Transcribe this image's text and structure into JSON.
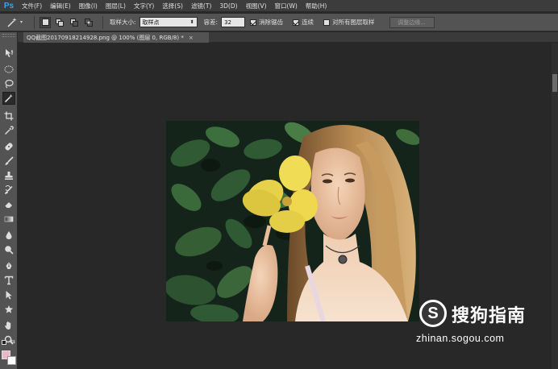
{
  "app": {
    "logo": "Ps"
  },
  "menubar": {
    "items": [
      "文件(F)",
      "编辑(E)",
      "图像(I)",
      "图层(L)",
      "文字(Y)",
      "选择(S)",
      "滤镜(T)",
      "3D(D)",
      "视图(V)",
      "窗口(W)",
      "帮助(H)"
    ]
  },
  "options": {
    "sample_size_label": "取样大小:",
    "sample_size_value": "取样点",
    "tolerance_label": "容差:",
    "tolerance_value": "32",
    "antialias_label": "消除锯齿",
    "antialias_checked": true,
    "contiguous_label": "连续",
    "contiguous_checked": true,
    "sample_all_label": "对所有图层取样",
    "sample_all_checked": false,
    "refine_edge_label": "调整边缘..."
  },
  "document": {
    "tab_title": "QQ截图20170918214928.png @ 100% (图层 0, RGB/8) *",
    "close": "×"
  },
  "toolbar": {
    "tools": [
      "move-tool",
      "marquee-tool",
      "lasso-tool",
      "magic-wand-tool",
      "crop-tool",
      "eyedropper-tool",
      "healing-brush-tool",
      "brush-tool",
      "clone-stamp-tool",
      "history-brush-tool",
      "eraser-tool",
      "gradient-tool",
      "blur-tool",
      "dodge-tool",
      "pen-tool",
      "type-tool",
      "path-selection-tool",
      "shape-tool",
      "hand-tool",
      "zoom-tool"
    ],
    "active_tool": "magic-wand-tool",
    "foreground_color": "#e8b8c8",
    "background_color": "#ffffff"
  },
  "watermark": {
    "logo_letter": "S",
    "title": "搜狗指南",
    "url": "zhinan.sogou.com"
  },
  "colors": {
    "menubar_bg": "#3c3c3c",
    "panel_bg": "#535353",
    "canvas_bg": "#282828",
    "logo_blue": "#31a8ff"
  }
}
